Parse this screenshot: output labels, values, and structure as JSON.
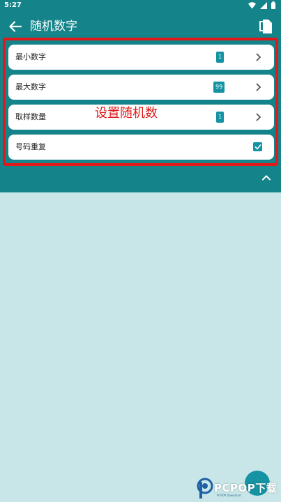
{
  "status_bar": {
    "time": "5:27"
  },
  "app_bar": {
    "title": "随机数字",
    "back_icon": "arrow-back-icon",
    "copy_icon": "copy-icon"
  },
  "settings": [
    {
      "label": "最小数字",
      "value": "1",
      "control": "chevron"
    },
    {
      "label": "最大数字",
      "value": "99",
      "control": "chevron"
    },
    {
      "label": "取样数量",
      "value": "1",
      "control": "chevron"
    },
    {
      "label": "号码重复",
      "checked": true,
      "control": "checkbox"
    }
  ],
  "annotation": "设置随机数",
  "watermark": {
    "brand": "PCPOP下载",
    "sub": "PCPOP Download"
  },
  "colors": {
    "primary": "#14848a",
    "accent": "#1593a2",
    "background": "#c8e6e7",
    "highlight": "#e11919"
  }
}
